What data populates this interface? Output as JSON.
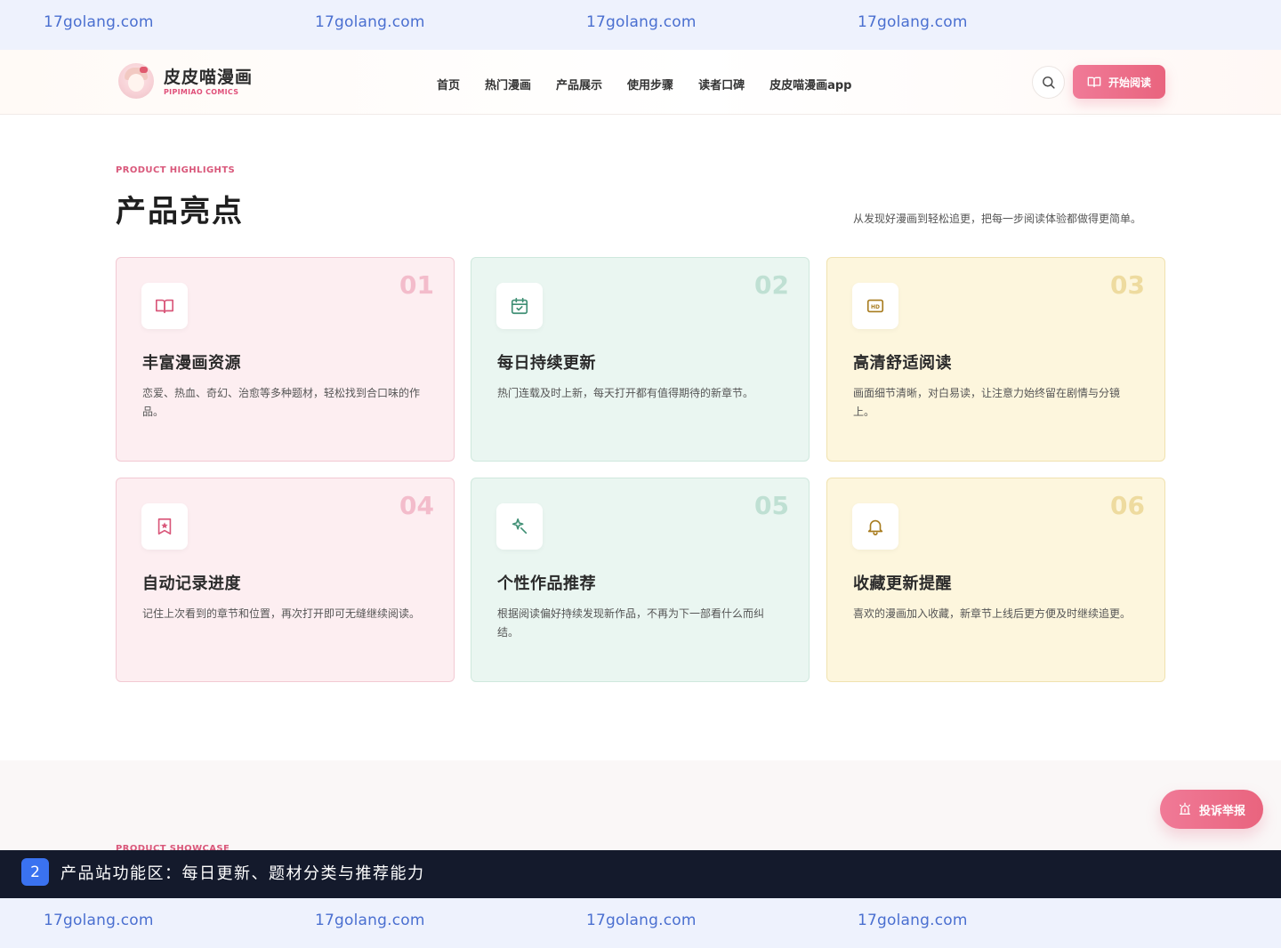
{
  "watermark": {
    "text": "17golang.com"
  },
  "header": {
    "logo_title": "皮皮喵漫画",
    "logo_subtitle": "PIPIMIAO COMICS",
    "nav": [
      "首页",
      "热门漫画",
      "产品展示",
      "使用步骤",
      "读者口碑",
      "皮皮喵漫画app"
    ],
    "start_label": "开始阅读"
  },
  "section": {
    "eyebrow": "PRODUCT HIGHLIGHTS",
    "title": "产品亮点",
    "description": "从发现好漫画到轻松追更，把每一步阅读体验都做得更简单。"
  },
  "cards": [
    {
      "num": "01",
      "title": "丰富漫画资源",
      "desc": "恋爱、热血、奇幻、治愈等多种题材，轻松找到合口味的作品。",
      "icon": "book-open-icon"
    },
    {
      "num": "02",
      "title": "每日持续更新",
      "desc": "热门连载及时上新，每天打开都有值得期待的新章节。",
      "icon": "calendar-check-icon"
    },
    {
      "num": "03",
      "title": "高清舒适阅读",
      "desc": "画面细节清晰，对白易读，让注意力始终留在剧情与分镜上。",
      "icon": "hd-icon"
    },
    {
      "num": "04",
      "title": "自动记录进度",
      "desc": "记住上次看到的章节和位置，再次打开即可无缝继续阅读。",
      "icon": "bookmark-star-icon"
    },
    {
      "num": "05",
      "title": "个性作品推荐",
      "desc": "根据阅读偏好持续发现新作品，不再为下一部看什么而纠结。",
      "icon": "sparkle-icon"
    },
    {
      "num": "06",
      "title": "收藏更新提醒",
      "desc": "喜欢的漫画加入收藏，新章节上线后更方便及时继续追更。",
      "icon": "bell-icon"
    }
  ],
  "next_section_eyebrow": "PRODUCT SHOWCASE",
  "report_label": "投诉举报",
  "caption": {
    "badge": "2",
    "text": "产品站功能区：每日更新、题材分类与推荐能力"
  },
  "colors": {
    "accent": "#e9647e",
    "pink_icon": "#d9577a",
    "mint_icon": "#3f8f74",
    "cream_icon": "#a87c1f"
  }
}
